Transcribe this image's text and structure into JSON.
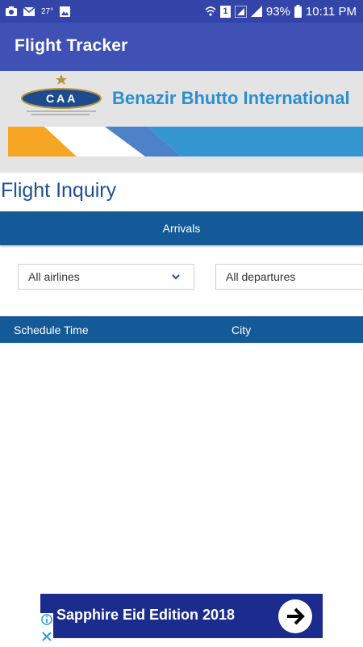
{
  "status_bar": {
    "temperature": "27°",
    "battery": "93%",
    "time": "10:11 PM",
    "sim_slot": "1",
    "icons": [
      "camera-icon",
      "email-icon",
      "image-icon",
      "wifi-icon",
      "signal-icon",
      "battery-icon"
    ]
  },
  "app": {
    "title": "Flight Tracker"
  },
  "banner": {
    "airport_name": "Benazir Bhutto International",
    "logo_text": "CAA"
  },
  "page": {
    "heading": "Flight Inquiry"
  },
  "tabs": {
    "arrivals_label": "Arrivals"
  },
  "filters": {
    "airline_selected": "All airlines",
    "departure_selected": "All departures"
  },
  "table": {
    "columns": [
      "Schedule Time",
      "City"
    ]
  },
  "ad": {
    "text": "Sapphire Eid Edition 2018"
  },
  "colors": {
    "status_bar": "#3345a8",
    "app_bar": "#3f51b5",
    "primary_blue": "#155a98",
    "heading": "#1d4f95",
    "banner_text": "#2a8fd0",
    "ad_bg": "#1b2b8e"
  }
}
